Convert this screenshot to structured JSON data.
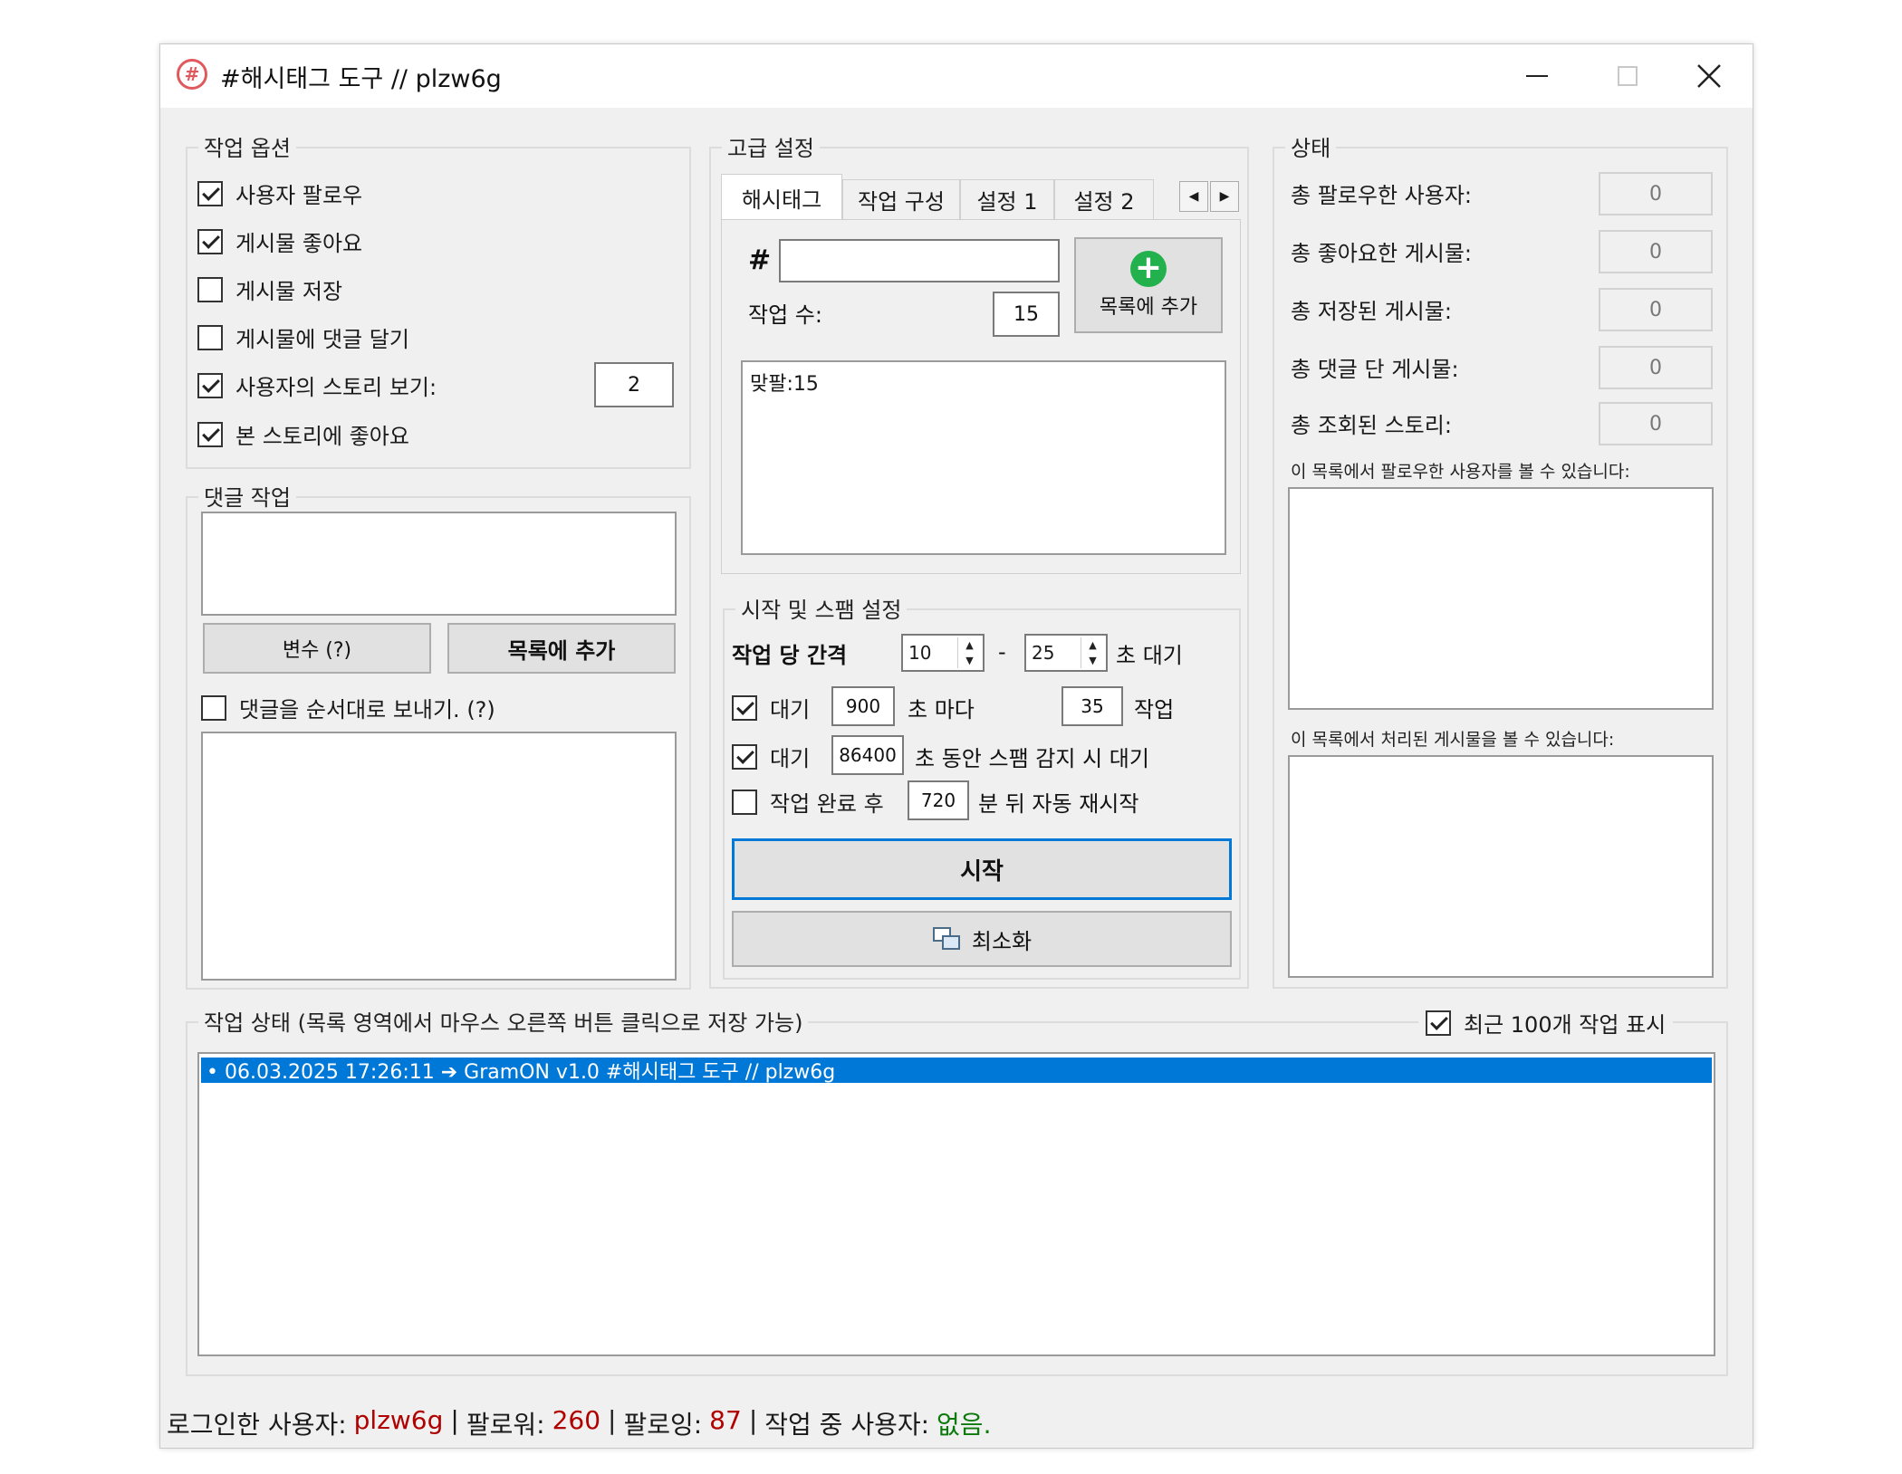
{
  "window": {
    "title": "#해시태그 도구 // plzw6g",
    "icon": "hashtag-icon"
  },
  "options": {
    "legend": "작업 옵션",
    "items": [
      {
        "label": "사용자 팔로우",
        "checked": true
      },
      {
        "label": "게시물 좋아요",
        "checked": true
      },
      {
        "label": "게시물 저장",
        "checked": false
      },
      {
        "label": "게시물에 댓글 달기",
        "checked": false
      },
      {
        "label": "사용자의 스토리 보기:",
        "checked": true
      },
      {
        "label": "본 스토리에 좋아요",
        "checked": true
      }
    ],
    "story_count": "2"
  },
  "comments": {
    "legend": "댓글 작업",
    "variables_button": "변수 (?)",
    "add_button": "목록에 추가",
    "sequential_label": "댓글을 순서대로 보내기. (?)"
  },
  "advanced": {
    "legend": "고급 설정",
    "tabs": [
      "해시태그",
      "작업 구성",
      "설정 1",
      "설정 2"
    ],
    "hash_symbol": "#",
    "hashtag_value": "",
    "task_count_label": "작업 수:",
    "task_count": "15",
    "add_button": "목록에 추가",
    "list_items": [
      "맞팔:15"
    ]
  },
  "spam": {
    "legend": "시작 및 스팸 설정",
    "interval_label": "작업 당 간격",
    "interval_min": "10",
    "dash": "-",
    "interval_max": "25",
    "interval_unit": "초 대기",
    "wait1": {
      "checked": true,
      "prefix": "대기",
      "value": "900",
      "mid": "초 마다",
      "count": "35",
      "suffix": "작업"
    },
    "wait2": {
      "checked": true,
      "prefix": "대기",
      "value": "86400",
      "suffix": "초 동안 스팸 감지 시 대기"
    },
    "restart": {
      "checked": false,
      "prefix": "작업 완료 후",
      "value": "720",
      "suffix": "분 뒤 자동 재시작"
    },
    "start_button": "시작",
    "minimize_button": "최소화"
  },
  "status": {
    "legend": "상태",
    "items": [
      {
        "label": "총 팔로우한 사용자:",
        "value": "0"
      },
      {
        "label": "총 좋아요한 게시물:",
        "value": "0"
      },
      {
        "label": "총 저장된 게시물:",
        "value": "0"
      },
      {
        "label": "총 댓글 단 게시물:",
        "value": "0"
      },
      {
        "label": "총 조회된 스토리:",
        "value": "0"
      }
    ],
    "followed_list_label": "이 목록에서 팔로우한 사용자를 볼 수 있습니다:",
    "processed_list_label": "이 목록에서 처리된 게시물을 볼 수 있습니다:"
  },
  "log": {
    "legend": "작업 상태 (목록 영역에서 마우스 오른쪽 버튼 클릭으로 저장 가능)",
    "show_recent_label": "최근 100개 작업 표시",
    "show_recent_checked": true,
    "entries": [
      "• 06.03.2025 17:26:11 ➔ GramON v1.0 #해시태그 도구 // plzw6g"
    ]
  },
  "statusbar": {
    "user_label": "로그인한 사용자:",
    "user": "plzw6g",
    "sep": "|",
    "followers_label": "팔로워:",
    "followers": "260",
    "following_label": "팔로잉:",
    "following": "87",
    "active_label": "작업 중 사용자:",
    "active": "없음."
  },
  "colors": {
    "accent": "#0078d7",
    "red_value": "#b00000",
    "green_value": "#0a7a0a",
    "add_green": "#22b14c"
  }
}
